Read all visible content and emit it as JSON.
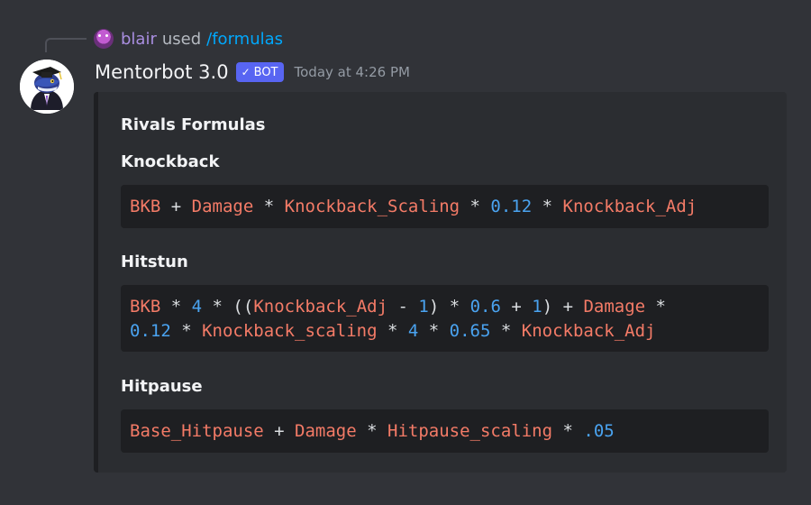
{
  "reply": {
    "user": "blair",
    "verb": "used",
    "command": "/formulas"
  },
  "message": {
    "author": "Mentorbot 3.0",
    "badge": "BOT",
    "badge_icon": "checkmark-icon",
    "timestamp": "Today at 4:26 PM"
  },
  "embed": {
    "title": "Rivals Formulas",
    "fields": [
      {
        "name": "Knockback",
        "lines": [
          [
            {
              "t": "BKB",
              "k": "var"
            },
            {
              "t": " + ",
              "k": "op"
            },
            {
              "t": "Damage",
              "k": "var"
            },
            {
              "t": " * ",
              "k": "op"
            },
            {
              "t": "Knockback_Scaling",
              "k": "var"
            },
            {
              "t": " * ",
              "k": "op"
            },
            {
              "t": "0.12",
              "k": "num"
            },
            {
              "t": " * ",
              "k": "op"
            },
            {
              "t": "Knockback_Adj",
              "k": "var"
            }
          ]
        ]
      },
      {
        "name": "Hitstun",
        "lines": [
          [
            {
              "t": "BKB",
              "k": "var"
            },
            {
              "t": " * ",
              "k": "op"
            },
            {
              "t": "4",
              "k": "num"
            },
            {
              "t": " * ((",
              "k": "op"
            },
            {
              "t": "Knockback_Adj",
              "k": "var"
            },
            {
              "t": " - ",
              "k": "op"
            },
            {
              "t": "1",
              "k": "num"
            },
            {
              "t": ") * ",
              "k": "op"
            },
            {
              "t": "0.6",
              "k": "num"
            },
            {
              "t": " + ",
              "k": "op"
            },
            {
              "t": "1",
              "k": "num"
            },
            {
              "t": ") + ",
              "k": "op"
            },
            {
              "t": "Damage",
              "k": "var"
            },
            {
              "t": " *",
              "k": "op"
            }
          ],
          [
            {
              "t": "0.12",
              "k": "num"
            },
            {
              "t": " * ",
              "k": "op"
            },
            {
              "t": "Knockback_scaling",
              "k": "var"
            },
            {
              "t": " * ",
              "k": "op"
            },
            {
              "t": "4",
              "k": "num"
            },
            {
              "t": " * ",
              "k": "op"
            },
            {
              "t": "0.65",
              "k": "num"
            },
            {
              "t": " * ",
              "k": "op"
            },
            {
              "t": "Knockback_Adj",
              "k": "var"
            }
          ]
        ]
      },
      {
        "name": "Hitpause",
        "lines": [
          [
            {
              "t": "Base_Hitpause",
              "k": "var"
            },
            {
              "t": " + ",
              "k": "op"
            },
            {
              "t": "Damage",
              "k": "var"
            },
            {
              "t": " * ",
              "k": "op"
            },
            {
              "t": "Hitpause_scaling",
              "k": "var"
            },
            {
              "t": " * ",
              "k": "op"
            },
            {
              "t": ".05",
              "k": "num"
            }
          ]
        ]
      }
    ]
  },
  "colors": {
    "background": "#313338",
    "embed_background": "#2b2d31",
    "code_background": "#1e1f22",
    "variable": "#f47b67",
    "number": "#4aa3f0",
    "command_link": "#00a8fc",
    "bot_badge": "#5865f2"
  }
}
